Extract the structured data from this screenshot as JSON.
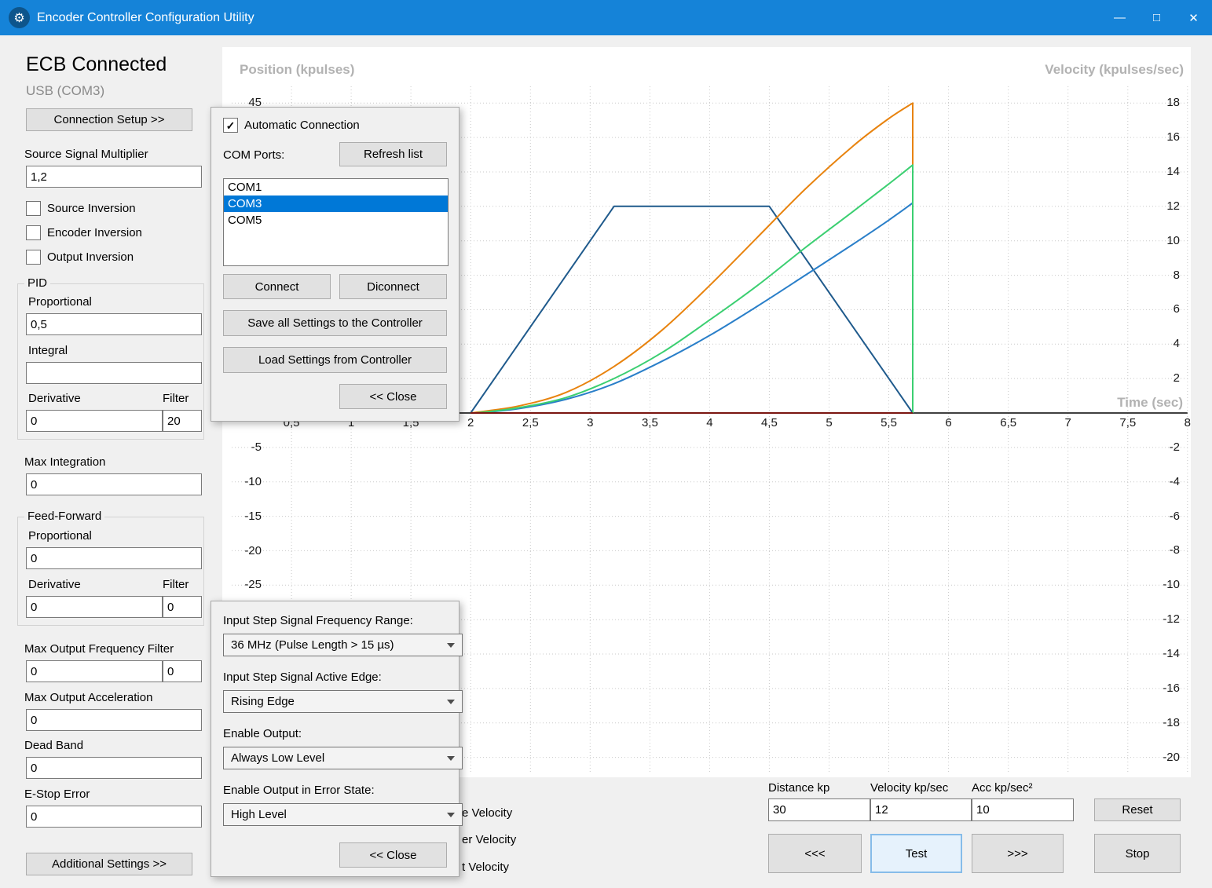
{
  "window": {
    "title": "Encoder Controller Configuration Utility",
    "icons": {
      "gear": "⚙",
      "minimize": "—",
      "maximize": "□",
      "close": "✕"
    }
  },
  "sidebar": {
    "status": "ECB Connected",
    "port": "USB (COM3)",
    "connection_setup_button": "Connection Setup >>",
    "source_signal_multiplier": {
      "label": "Source Signal Multiplier",
      "value": "1,2"
    },
    "checkboxes": [
      {
        "label": "Source Inversion",
        "checked": false
      },
      {
        "label": "Encoder Inversion",
        "checked": false
      },
      {
        "label": "Output Inversion",
        "checked": false
      }
    ],
    "pid": {
      "title": "PID",
      "proportional_label": "Proportional",
      "proportional": "0,5",
      "integral_label": "Integral",
      "integral": "",
      "derivative_label": "Derivative",
      "filter_label": "Filter",
      "derivative": "0",
      "filter": "20"
    },
    "max_integration": {
      "label": "Max Integration",
      "value": "0"
    },
    "feed_forward": {
      "title": "Feed-Forward",
      "proportional_label": "Proportional",
      "proportional": "0",
      "derivative_label": "Derivative",
      "filter_label": "Filter",
      "derivative": "0",
      "filter": "0"
    },
    "max_output_frequency_filter": {
      "label": "Max Output Frequency Filter",
      "value1": "0",
      "value2": "0"
    },
    "max_output_acceleration": {
      "label": "Max Output Acceleration",
      "value": "0"
    },
    "dead_band": {
      "label": "Dead Band",
      "value": "0"
    },
    "e_stop_error": {
      "label": "E-Stop Error",
      "value": "0"
    },
    "additional_settings_button": "Additional Settings >>"
  },
  "connection_popup": {
    "auto_label": "Automatic Connection",
    "auto_checked": true,
    "auto_glyph": "✓",
    "com_ports_label": "COM Ports:",
    "refresh_button": "Refresh list",
    "ports": [
      "COM1",
      "COM3",
      "COM5"
    ],
    "selected_port": "COM3",
    "connect_button": "Connect",
    "disconnect_button": "Diconnect",
    "save_button": "Save all Settings to the Controller",
    "load_button": "Load Settings from Controller",
    "close_button": "<< Close"
  },
  "signal_popup": {
    "frequency_label": "Input Step Signal Frequency Range:",
    "frequency_value": "36 MHz (Pulse Length > 15 µs)",
    "edge_label": "Input Step Signal Active Edge:",
    "edge_value": "Rising Edge",
    "enable_output_label": "Enable Output:",
    "enable_output_value": "Always Low Level",
    "error_state_label": "Enable Output in Error State:",
    "error_state_value": "High Level",
    "close_button": "<< Close"
  },
  "legend_fragments": [
    "e Velocity",
    "er Velocity",
    "t Velocity"
  ],
  "motion_controls": {
    "distance_label": "Distance kp",
    "distance_value": "30",
    "velocity_label": "Velocity kp/sec",
    "velocity_value": "12",
    "acc_label": "Acc  kp/sec²",
    "acc_value": "10",
    "reset_button": "Reset",
    "back_button": "<<<",
    "test_button": "Test",
    "forward_button": ">>>",
    "stop_button": "Stop"
  },
  "chart_data": {
    "type": "line",
    "left_axis_label": "Position (kpulses)",
    "right_axis_label": "Velocity (kpulses/sec)",
    "x_axis_label": "Time (sec)",
    "x_range": [
      0,
      8
    ],
    "right_range": [
      -20,
      18
    ],
    "grid": {
      "x_step": 0.5,
      "y_step": 2,
      "style": "dotted"
    },
    "x_ticks": {
      "values": [
        0.5,
        1,
        1.5,
        2,
        2.5,
        3,
        3.5,
        4,
        4.5,
        5,
        5.5,
        6,
        6.5,
        7,
        7.5,
        8
      ],
      "labels": [
        "0,5",
        "1",
        "1,5",
        "2",
        "2,5",
        "3",
        "3,5",
        "4",
        "4,5",
        "5",
        "5,5",
        "6",
        "6,5",
        "7",
        "7,5",
        "8"
      ]
    },
    "left_ticks": {
      "values": [
        45,
        -5,
        -10,
        -15,
        -20,
        -25
      ],
      "labels": [
        "45",
        "-5",
        "-10",
        "-15",
        "-20",
        "-25"
      ]
    },
    "right_ticks": {
      "values": [
        18,
        16,
        14,
        12,
        10,
        8,
        6,
        4,
        2,
        -2,
        -4,
        -6,
        -8,
        -10,
        -12,
        -14,
        -16,
        -18,
        -20
      ],
      "labels": [
        "18",
        "16",
        "14",
        "12",
        "10",
        "8",
        "6",
        "4",
        "2",
        "-2",
        "-4",
        "-6",
        "-8",
        "-10",
        "-12",
        "-14",
        "-16",
        "-18",
        "-20"
      ]
    },
    "series": [
      {
        "name": "velocity-profile",
        "color": "#1f5a8c",
        "smooth": false,
        "drop": false,
        "points": [
          [
            2,
            0
          ],
          [
            3.2,
            12
          ],
          [
            4.5,
            12
          ],
          [
            5.7,
            0
          ]
        ]
      },
      {
        "name": "response-orange",
        "color": "#e8830e",
        "smooth": true,
        "drop": true,
        "points": [
          [
            2,
            0
          ],
          [
            2.4,
            0.4
          ],
          [
            2.8,
            1.2
          ],
          [
            3.2,
            2.7
          ],
          [
            3.6,
            4.8
          ],
          [
            4,
            7.4
          ],
          [
            4.4,
            10.2
          ],
          [
            4.8,
            13
          ],
          [
            5.2,
            15.5
          ],
          [
            5.5,
            17.1
          ],
          [
            5.7,
            18
          ]
        ]
      },
      {
        "name": "response-blue",
        "color": "#2a7fc9",
        "smooth": true,
        "drop": true,
        "points": [
          [
            2.05,
            0
          ],
          [
            2.4,
            0.25
          ],
          [
            2.8,
            0.8
          ],
          [
            3.2,
            1.7
          ],
          [
            3.6,
            3
          ],
          [
            4,
            4.5
          ],
          [
            4.4,
            6.2
          ],
          [
            4.8,
            8
          ],
          [
            5.2,
            9.8
          ],
          [
            5.5,
            11.2
          ],
          [
            5.7,
            12.2
          ]
        ]
      },
      {
        "name": "response-green",
        "color": "#3bcf71",
        "smooth": true,
        "drop": true,
        "points": [
          [
            2.05,
            0
          ],
          [
            2.4,
            0.3
          ],
          [
            2.8,
            0.9
          ],
          [
            3.2,
            2
          ],
          [
            3.6,
            3.5
          ],
          [
            4,
            5.4
          ],
          [
            4.4,
            7.4
          ],
          [
            4.8,
            9.6
          ],
          [
            5.2,
            11.7
          ],
          [
            5.5,
            13.3
          ],
          [
            5.7,
            14.4
          ]
        ]
      },
      {
        "name": "zero-baseline",
        "color": "#7a1510",
        "smooth": false,
        "drop": false,
        "points": [
          [
            2,
            0
          ],
          [
            5.7,
            0
          ]
        ]
      }
    ]
  }
}
